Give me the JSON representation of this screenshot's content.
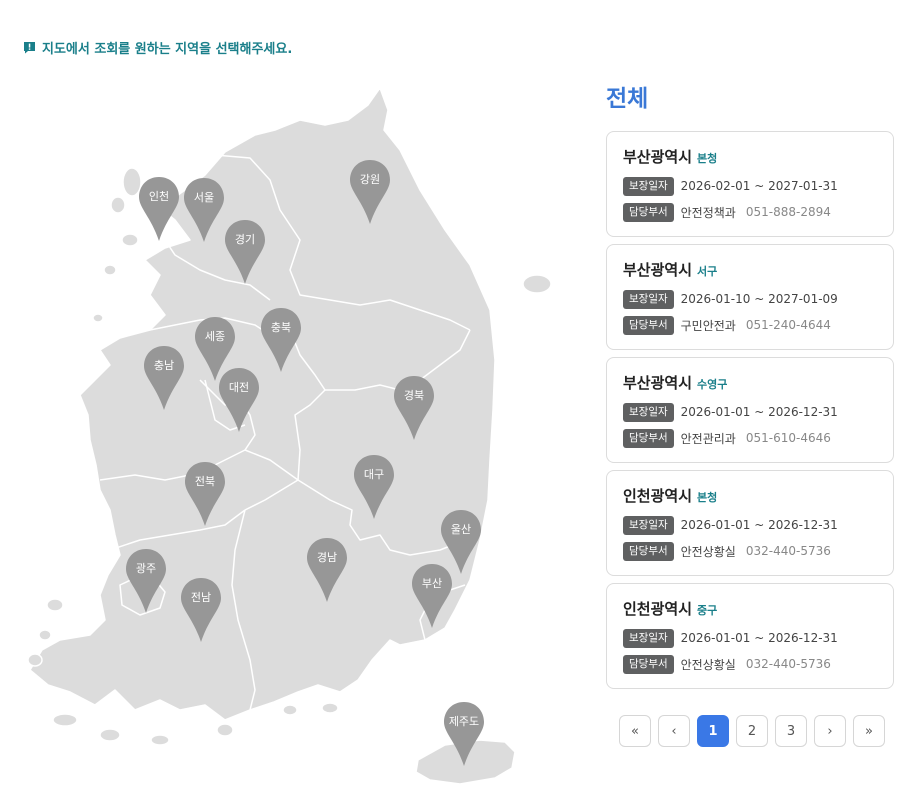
{
  "notice": {
    "text": "지도에서 조회를 원하는 지역을 선택해주세요."
  },
  "map": {
    "pins": [
      {
        "key": "incheon",
        "label": "인천"
      },
      {
        "key": "seoul",
        "label": "서울"
      },
      {
        "key": "gyeonggi",
        "label": "경기"
      },
      {
        "key": "gangwon",
        "label": "강원"
      },
      {
        "key": "sejong",
        "label": "세종"
      },
      {
        "key": "chungbuk",
        "label": "충북"
      },
      {
        "key": "chungnam",
        "label": "충남"
      },
      {
        "key": "daejeon",
        "label": "대전"
      },
      {
        "key": "gyeongbuk",
        "label": "경북"
      },
      {
        "key": "daegu",
        "label": "대구"
      },
      {
        "key": "jeonbuk",
        "label": "전북"
      },
      {
        "key": "ulsan",
        "label": "울산"
      },
      {
        "key": "gyeongnam",
        "label": "경남"
      },
      {
        "key": "gwangju",
        "label": "광주"
      },
      {
        "key": "jeonnam",
        "label": "전남"
      },
      {
        "key": "busan",
        "label": "부산"
      },
      {
        "key": "jeju",
        "label": "제주도"
      }
    ]
  },
  "panel": {
    "title": "전체",
    "cards": [
      {
        "city": "부산광역시",
        "office": "본청",
        "period_label": "보장일자",
        "period": "2026-02-01 ~ 2027-01-31",
        "dept_label": "담당부서",
        "dept": "안전정책과",
        "phone": "051-888-2894"
      },
      {
        "city": "부산광역시",
        "office": "서구",
        "period_label": "보장일자",
        "period": "2026-01-10 ~ 2027-01-09",
        "dept_label": "담당부서",
        "dept": "구민안전과",
        "phone": "051-240-4644"
      },
      {
        "city": "부산광역시",
        "office": "수영구",
        "period_label": "보장일자",
        "period": "2026-01-01 ~ 2026-12-31",
        "dept_label": "담당부서",
        "dept": "안전관리과",
        "phone": "051-610-4646"
      },
      {
        "city": "인천광역시",
        "office": "본청",
        "period_label": "보장일자",
        "period": "2026-01-01 ~ 2026-12-31",
        "dept_label": "담당부서",
        "dept": "안전상황실",
        "phone": "032-440-5736"
      },
      {
        "city": "인천광역시",
        "office": "중구",
        "period_label": "보장일자",
        "period": "2026-01-01 ~ 2026-12-31",
        "dept_label": "담당부서",
        "dept": "안전상황실",
        "phone": "032-440-5736"
      }
    ]
  },
  "pagination": {
    "first": "«",
    "prev": "‹",
    "pages": [
      "1",
      "2",
      "3"
    ],
    "current": "1",
    "next": "›",
    "last": "»"
  },
  "colors": {
    "accent_teal": "#1a7f8a",
    "title_blue": "#3a78d6",
    "active_page": "#3a78e6",
    "pin_gray": "#979797",
    "map_fill": "#dcdcdc"
  }
}
